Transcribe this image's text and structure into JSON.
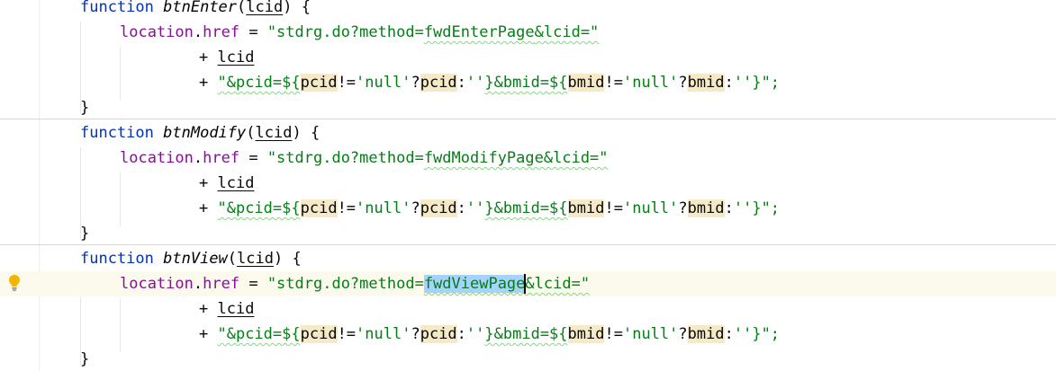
{
  "theme": {
    "keyword": "#0033b3",
    "string": "#067d17",
    "property": "#871094",
    "selection": "#a6d2ff",
    "current_line": "#fcfaed",
    "identifier_highlight": "#f5e9c6"
  },
  "gutter": {
    "intention_icon": "lightbulb-icon"
  },
  "code": {
    "kw_function": "function",
    "blocks": [
      {
        "name": "btnEnter",
        "param": "lcid",
        "assign_prefix": "location",
        "href": "href",
        "eq": " = ",
        "str_a": "\"stdrg.do?method=",
        "method": "fwdEnterPage",
        "str_b": "&lcid=\"",
        "plus": "+ ",
        "lcid": "lcid",
        "str_pcid": "\"&pcid=${",
        "pcid": "pcid",
        "neq": "!=",
        "null": "'null'",
        "q": "?",
        "colon": ":",
        "empty": "''",
        "close_bmid": "}&bmid=${",
        "bmid": "bmid",
        "end": "}\";",
        "close_brace": "}"
      },
      {
        "name": "btnModify",
        "param": "lcid",
        "assign_prefix": "location",
        "href": "href",
        "eq": " = ",
        "str_a": "\"stdrg.do?method=",
        "method": "fwdModifyPage",
        "str_b": "&lcid=\"",
        "plus": "+ ",
        "lcid": "lcid",
        "str_pcid": "\"&pcid=${",
        "pcid": "pcid",
        "neq": "!=",
        "null": "'null'",
        "q": "?",
        "colon": ":",
        "empty": "''",
        "close_bmid": "}&bmid=${",
        "bmid": "bmid",
        "end": "}\";",
        "close_brace": "}"
      },
      {
        "name": "btnView",
        "param": "lcid",
        "assign_prefix": "location",
        "href": "href",
        "eq": " = ",
        "str_a": "\"stdrg.do?method=",
        "method": "fwdViewPage",
        "str_b": "&lcid=\"",
        "plus": "+ ",
        "lcid": "lcid",
        "str_pcid": "\"&pcid=${",
        "pcid": "pcid",
        "neq": "!=",
        "null": "'null'",
        "q": "?",
        "colon": ":",
        "empty": "''",
        "close_bmid": "}&bmid=${",
        "bmid": "bmid",
        "end": "}\";",
        "close_brace": "}"
      }
    ]
  }
}
